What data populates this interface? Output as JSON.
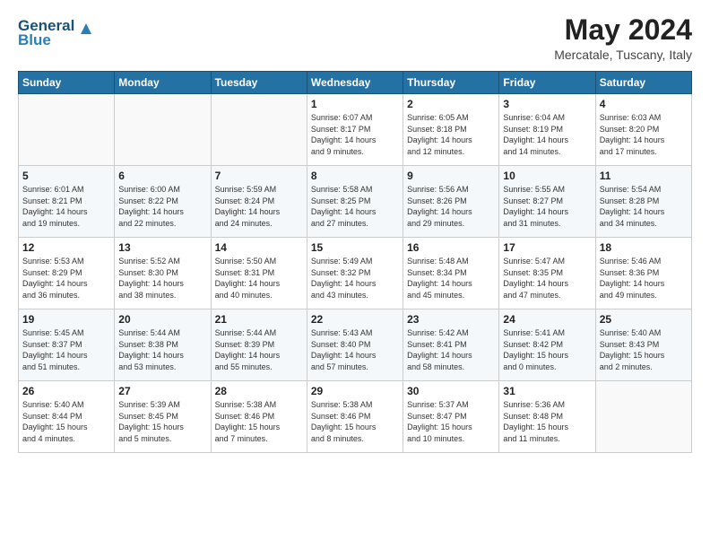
{
  "logo": {
    "line1": "General",
    "line2": "Blue"
  },
  "title": "May 2024",
  "location": "Mercatale, Tuscany, Italy",
  "weekdays": [
    "Sunday",
    "Monday",
    "Tuesday",
    "Wednesday",
    "Thursday",
    "Friday",
    "Saturday"
  ],
  "weeks": [
    [
      {
        "day": "",
        "info": ""
      },
      {
        "day": "",
        "info": ""
      },
      {
        "day": "",
        "info": ""
      },
      {
        "day": "1",
        "info": "Sunrise: 6:07 AM\nSunset: 8:17 PM\nDaylight: 14 hours\nand 9 minutes."
      },
      {
        "day": "2",
        "info": "Sunrise: 6:05 AM\nSunset: 8:18 PM\nDaylight: 14 hours\nand 12 minutes."
      },
      {
        "day": "3",
        "info": "Sunrise: 6:04 AM\nSunset: 8:19 PM\nDaylight: 14 hours\nand 14 minutes."
      },
      {
        "day": "4",
        "info": "Sunrise: 6:03 AM\nSunset: 8:20 PM\nDaylight: 14 hours\nand 17 minutes."
      }
    ],
    [
      {
        "day": "5",
        "info": "Sunrise: 6:01 AM\nSunset: 8:21 PM\nDaylight: 14 hours\nand 19 minutes."
      },
      {
        "day": "6",
        "info": "Sunrise: 6:00 AM\nSunset: 8:22 PM\nDaylight: 14 hours\nand 22 minutes."
      },
      {
        "day": "7",
        "info": "Sunrise: 5:59 AM\nSunset: 8:24 PM\nDaylight: 14 hours\nand 24 minutes."
      },
      {
        "day": "8",
        "info": "Sunrise: 5:58 AM\nSunset: 8:25 PM\nDaylight: 14 hours\nand 27 minutes."
      },
      {
        "day": "9",
        "info": "Sunrise: 5:56 AM\nSunset: 8:26 PM\nDaylight: 14 hours\nand 29 minutes."
      },
      {
        "day": "10",
        "info": "Sunrise: 5:55 AM\nSunset: 8:27 PM\nDaylight: 14 hours\nand 31 minutes."
      },
      {
        "day": "11",
        "info": "Sunrise: 5:54 AM\nSunset: 8:28 PM\nDaylight: 14 hours\nand 34 minutes."
      }
    ],
    [
      {
        "day": "12",
        "info": "Sunrise: 5:53 AM\nSunset: 8:29 PM\nDaylight: 14 hours\nand 36 minutes."
      },
      {
        "day": "13",
        "info": "Sunrise: 5:52 AM\nSunset: 8:30 PM\nDaylight: 14 hours\nand 38 minutes."
      },
      {
        "day": "14",
        "info": "Sunrise: 5:50 AM\nSunset: 8:31 PM\nDaylight: 14 hours\nand 40 minutes."
      },
      {
        "day": "15",
        "info": "Sunrise: 5:49 AM\nSunset: 8:32 PM\nDaylight: 14 hours\nand 43 minutes."
      },
      {
        "day": "16",
        "info": "Sunrise: 5:48 AM\nSunset: 8:34 PM\nDaylight: 14 hours\nand 45 minutes."
      },
      {
        "day": "17",
        "info": "Sunrise: 5:47 AM\nSunset: 8:35 PM\nDaylight: 14 hours\nand 47 minutes."
      },
      {
        "day": "18",
        "info": "Sunrise: 5:46 AM\nSunset: 8:36 PM\nDaylight: 14 hours\nand 49 minutes."
      }
    ],
    [
      {
        "day": "19",
        "info": "Sunrise: 5:45 AM\nSunset: 8:37 PM\nDaylight: 14 hours\nand 51 minutes."
      },
      {
        "day": "20",
        "info": "Sunrise: 5:44 AM\nSunset: 8:38 PM\nDaylight: 14 hours\nand 53 minutes."
      },
      {
        "day": "21",
        "info": "Sunrise: 5:44 AM\nSunset: 8:39 PM\nDaylight: 14 hours\nand 55 minutes."
      },
      {
        "day": "22",
        "info": "Sunrise: 5:43 AM\nSunset: 8:40 PM\nDaylight: 14 hours\nand 57 minutes."
      },
      {
        "day": "23",
        "info": "Sunrise: 5:42 AM\nSunset: 8:41 PM\nDaylight: 14 hours\nand 58 minutes."
      },
      {
        "day": "24",
        "info": "Sunrise: 5:41 AM\nSunset: 8:42 PM\nDaylight: 15 hours\nand 0 minutes."
      },
      {
        "day": "25",
        "info": "Sunrise: 5:40 AM\nSunset: 8:43 PM\nDaylight: 15 hours\nand 2 minutes."
      }
    ],
    [
      {
        "day": "26",
        "info": "Sunrise: 5:40 AM\nSunset: 8:44 PM\nDaylight: 15 hours\nand 4 minutes."
      },
      {
        "day": "27",
        "info": "Sunrise: 5:39 AM\nSunset: 8:45 PM\nDaylight: 15 hours\nand 5 minutes."
      },
      {
        "day": "28",
        "info": "Sunrise: 5:38 AM\nSunset: 8:46 PM\nDaylight: 15 hours\nand 7 minutes."
      },
      {
        "day": "29",
        "info": "Sunrise: 5:38 AM\nSunset: 8:46 PM\nDaylight: 15 hours\nand 8 minutes."
      },
      {
        "day": "30",
        "info": "Sunrise: 5:37 AM\nSunset: 8:47 PM\nDaylight: 15 hours\nand 10 minutes."
      },
      {
        "day": "31",
        "info": "Sunrise: 5:36 AM\nSunset: 8:48 PM\nDaylight: 15 hours\nand 11 minutes."
      },
      {
        "day": "",
        "info": ""
      }
    ]
  ]
}
